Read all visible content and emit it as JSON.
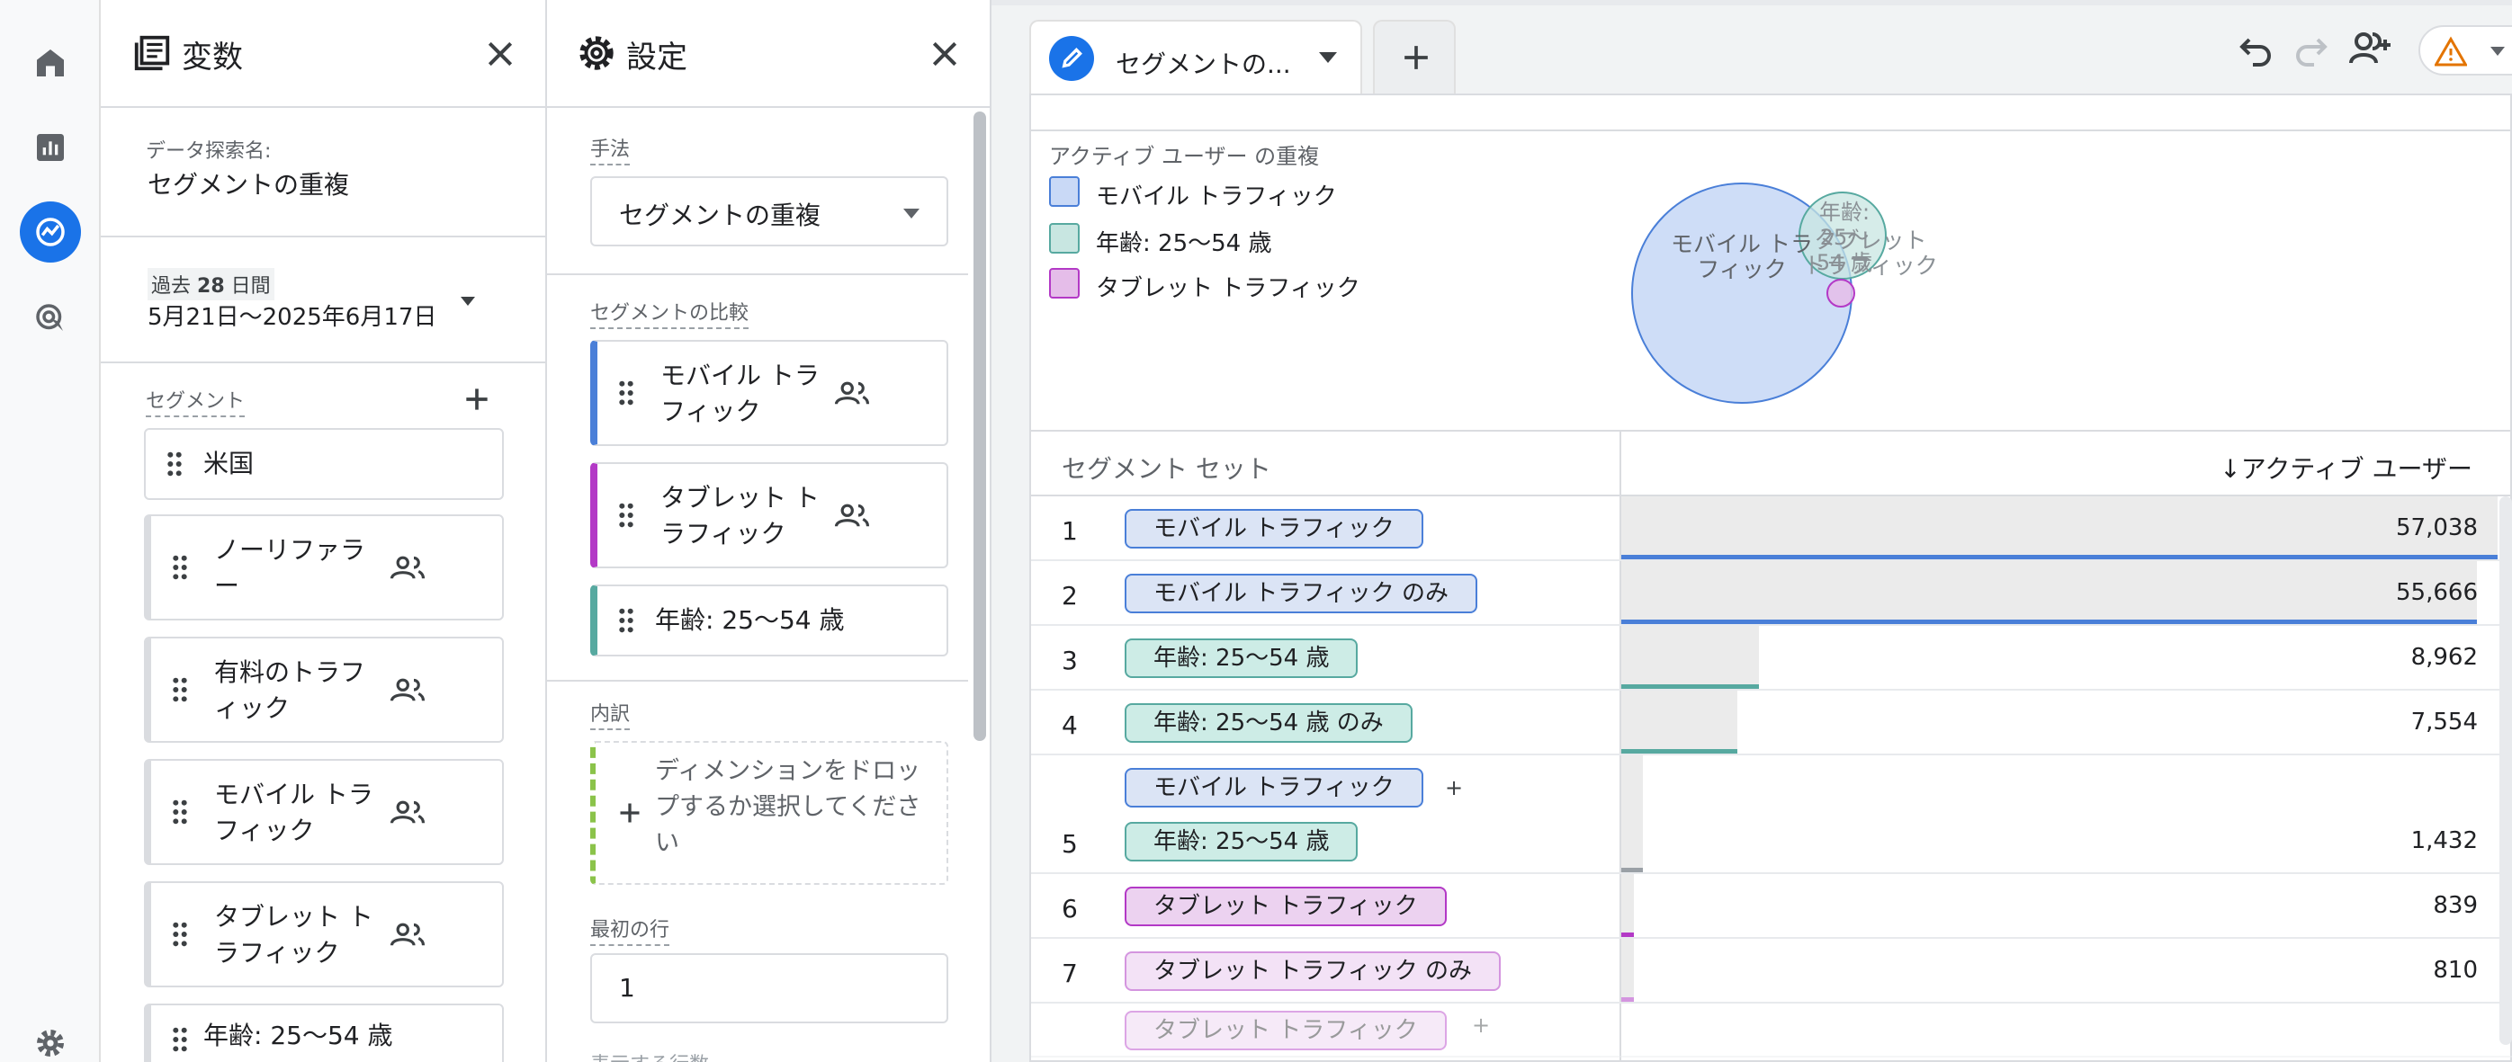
{
  "colors": {
    "accent": "#1a73e8",
    "mobile": "#4a7fd8",
    "age": "#57a9a0",
    "tablet": "#b339c6"
  },
  "nav": {
    "items": [
      "home-icon",
      "reports-icon",
      "explore-icon",
      "advertising-icon",
      "gear-icon"
    ]
  },
  "variables": {
    "title": "変数",
    "exploration_name_label": "データ探索名:",
    "exploration_name": "セグメントの重複",
    "date_range_prefix": "過去",
    "date_range_days": "28",
    "date_range_suffix": "日間",
    "date_range_value": "5月21日〜2025年6月17日",
    "segments_label": "セグメント",
    "segments": [
      "米国",
      "ノーリファラー",
      "有料のトラフィック",
      "モバイル トラフィック",
      "タブレット トラフィック",
      "年齢: 25〜54 歳"
    ]
  },
  "settings": {
    "title": "設定",
    "method_label": "手法",
    "method_value": "セグメントの重複",
    "compare_label": "セグメントの比較",
    "compare_segments": [
      "モバイル トラフィック",
      "タブレット トラフィック",
      "年齢: 25〜54 歳"
    ],
    "breakdown_label": "内訳",
    "breakdown_placeholder": "ディメンションをドロップするか選択してください",
    "first_row_label": "最初の行",
    "first_row_value": "1",
    "rows_label_partial": "表示する行数"
  },
  "tab": {
    "label": "セグメントの..."
  },
  "venn": {
    "title": "アクティブ ユーザー の重複",
    "legend": [
      "モバイル トラフィック",
      "年齢: 25〜54 歳",
      "タブレット トラフィック"
    ],
    "labels": {
      "mobile": "モバイル トラフィック",
      "age": "年齢: 25〜54 歳",
      "tablet": "タブレット トラフィック"
    }
  },
  "table": {
    "col_segment": "セグメント セット",
    "col_metric": "↓アクティブ ユーザー",
    "max": 57038,
    "rows": [
      {
        "idx": "1",
        "chips": [
          "モバイル トラフィック"
        ],
        "kinds": [
          "mobile"
        ],
        "value": "57,038",
        "num": 57038,
        "kind": "mobile"
      },
      {
        "idx": "2",
        "chips": [
          "モバイル トラフィック のみ"
        ],
        "kinds": [
          "mobile"
        ],
        "value": "55,666",
        "num": 55666,
        "kind": "mobile"
      },
      {
        "idx": "3",
        "chips": [
          "年齢: 25〜54 歳"
        ],
        "kinds": [
          "age"
        ],
        "value": "8,962",
        "num": 8962,
        "kind": "age"
      },
      {
        "idx": "4",
        "chips": [
          "年齢: 25〜54 歳 のみ"
        ],
        "kinds": [
          "age"
        ],
        "value": "7,554",
        "num": 7554,
        "kind": "age"
      },
      {
        "idx": "5",
        "chips": [
          "モバイル トラフィック",
          "年齢: 25〜54 歳"
        ],
        "kinds": [
          "mobile",
          "age"
        ],
        "value": "1,432",
        "num": 1432,
        "kind": "gray"
      },
      {
        "idx": "6",
        "chips": [
          "タブレット トラフィック"
        ],
        "kinds": [
          "tablet"
        ],
        "value": "839",
        "num": 839,
        "kind": "tablet"
      },
      {
        "idx": "7",
        "chips": [
          "タブレット トラフィック のみ"
        ],
        "kinds": [
          "tablet"
        ],
        "value": "810",
        "num": 810,
        "kind": "tabletlight"
      },
      {
        "idx": "",
        "chips": [
          "タブレット トラフィック"
        ],
        "kinds": [
          "tablet"
        ],
        "value": "",
        "num": 0,
        "kind": "tablet"
      }
    ]
  }
}
